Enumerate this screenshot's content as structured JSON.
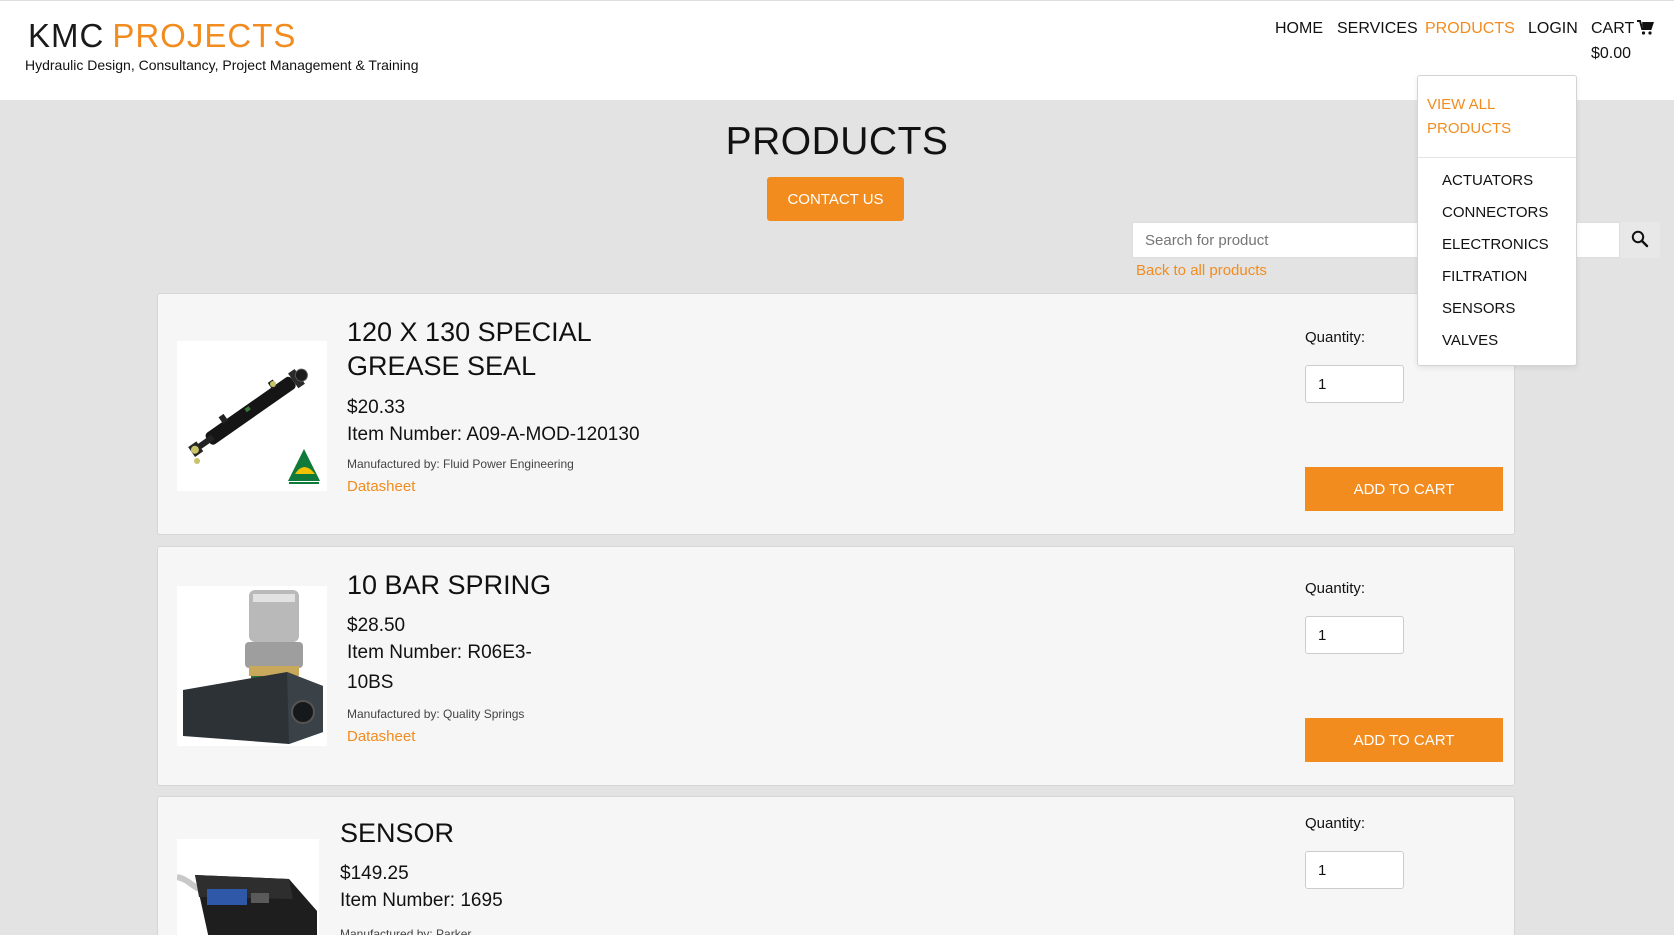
{
  "brand": {
    "name_left": "KMC",
    "name_right": "PROJECTS",
    "tagline": "Hydraulic Design, Consultancy, Project Management & Training"
  },
  "nav": {
    "home": "HOME",
    "services": "SERVICES",
    "products": "PRODUCTS",
    "login": "LOGIN",
    "cart": "CART",
    "cart_total": "$0.00"
  },
  "dropdown": {
    "view_all": "VIEW ALL PRODUCTS",
    "items": [
      "ACTUATORS",
      "CONNECTORS",
      "ELECTRONICS",
      "FILTRATION",
      "SENSORS",
      "VALVES"
    ]
  },
  "page": {
    "title": "PRODUCTS",
    "contact_label": "CONTACT US"
  },
  "search": {
    "placeholder": "Search for product",
    "back_link": "Back to all products"
  },
  "products": [
    {
      "name": "120 X 130 SPECIAL GREASE SEAL",
      "price": "$20.33",
      "item_number": "Item Number: A09-A-MOD-120130",
      "manufacturer": "Manufactured by: Fluid Power Engineering",
      "datasheet": "Datasheet",
      "quantity_label": "Quantity:",
      "quantity": "1",
      "add_label": "ADD TO CART"
    },
    {
      "name": "10 BAR SPRING",
      "price": "$28.50",
      "item_number": "Item Number: R06E3-10BS",
      "manufacturer": "Manufactured by: Quality Springs",
      "datasheet": "Datasheet",
      "quantity_label": "Quantity:",
      "quantity": "1",
      "add_label": "ADD TO CART"
    },
    {
      "name": "SENSOR",
      "price": "$149.25",
      "item_number": "Item Number: 1695",
      "manufacturer": "Manufactured by: Parker",
      "quantity_label": "Quantity:",
      "quantity": "1"
    }
  ],
  "icons": {
    "cart": "cart-icon",
    "search": "search-icon"
  },
  "colors": {
    "accent": "#f28c1e",
    "background": "#e3e3e3",
    "card": "#f6f6f6"
  }
}
